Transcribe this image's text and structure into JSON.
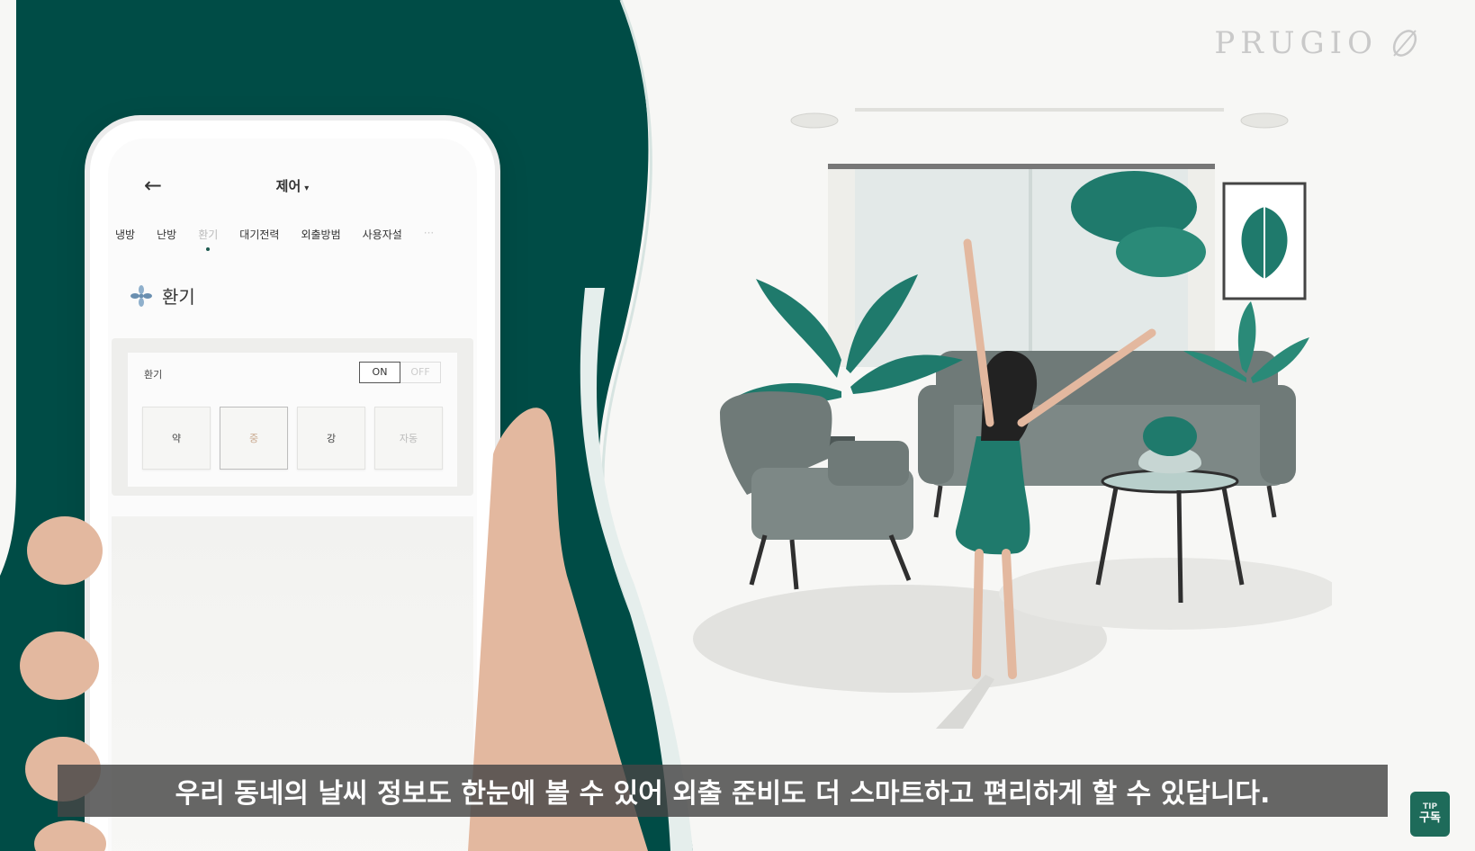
{
  "brand": {
    "name": "PRUGIO",
    "logo_icon": "leaf-icon"
  },
  "phone": {
    "back_icon": "←",
    "title": "제어",
    "title_caret": "▾",
    "tabs": [
      "냉방",
      "난방",
      "환기",
      "대기전력",
      "외출방범",
      "사용자설",
      "···"
    ],
    "active_tab_index": 2,
    "section_title": "환기",
    "section_icon": "fan-icon",
    "control": {
      "label": "환기",
      "toggle_on": "ON",
      "toggle_off": "OFF",
      "levels": [
        "약",
        "중",
        "강",
        "자동"
      ],
      "selected_level_index": 1
    }
  },
  "subtitle": "우리 동네의 날씨 정보도 한눈에 볼 수 있어 외출 준비도 더 스마트하고 편리하게 할 수 있답니다.",
  "subscribe_badge": {
    "top": "TIP",
    "label": "구독"
  },
  "colors": {
    "dark_green": "#004c46",
    "teal": "#1e6b5a",
    "skin": "#e3b89f",
    "sofa": "#6f7a78",
    "plant": "#1f7a6c"
  }
}
